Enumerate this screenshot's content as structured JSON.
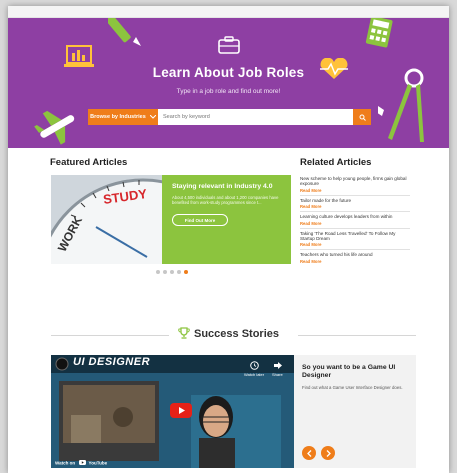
{
  "hero": {
    "title": "Learn About Job Roles",
    "subtitle": "Type in a job role and find out more!",
    "browse_label": "Browse by Industries",
    "search_placeholder": "Search by keyword",
    "bg_color": "#8e3fa3",
    "accent_color": "#ef7d1a"
  },
  "featured": {
    "heading": "Featured Articles",
    "image_word_1": "STUDY",
    "image_word_2": "WORK",
    "article_title": "Staying relevant in Industry 4.0",
    "article_desc": "About 4,500 individuals and about 1,200 companies have benefited from work-study programmes since t...",
    "button_label": "Find Out More",
    "slide_count": 5,
    "active_slide": 5
  },
  "related": {
    "heading": "Related Articles",
    "items": [
      {
        "title": "New scheme to help young people, firms gain global exposure",
        "more": "Read More"
      },
      {
        "title": "Tailor made for the future",
        "more": "Read More"
      },
      {
        "title": "Learning culture develops leaders from within",
        "more": "Read More"
      },
      {
        "title": "Taking 'The Road Less Travelled' To Follow My Startup Dream",
        "more": "Read More"
      },
      {
        "title": "Teachers who turned his life around",
        "more": "Read More"
      }
    ]
  },
  "success": {
    "heading": "Success Stories",
    "video_title": "UI DESIGNER",
    "watch_later": "Watch later",
    "share": "Share",
    "watch_on": "Watch on",
    "youtube": "YouTube",
    "story_title": "So you want to be a Game UI Designer",
    "story_desc": "Find out what a Game User Interface Designer does."
  }
}
